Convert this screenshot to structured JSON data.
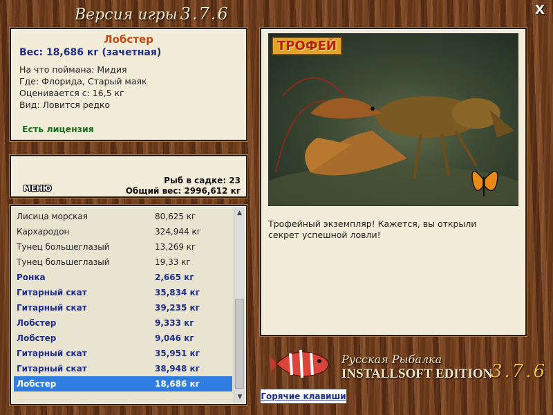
{
  "window": {
    "title_prefix": "Версия игры",
    "title_version": "3.7.6",
    "close_label": "X"
  },
  "fish": {
    "name": "Лобстер",
    "weight": "Вес: 18,686 кг (зачетная)",
    "bait": "На что поймана: Мидия",
    "location": "Где: Флорида, Старый маяк",
    "value": "Оценивается с: 16,5 кг",
    "kind": "Вид: Ловится редко",
    "license": "Есть лицензия"
  },
  "stats": {
    "fish_count": "Рыб в садке: 23",
    "total_weight": "Общий вес: 2996,612 кг",
    "menu_label": "МЕНЮ"
  },
  "catch_list": [
    {
      "name": "Лисица морская",
      "weight": "80,625 кг",
      "bold": false
    },
    {
      "name": "Кархародон",
      "weight": "324,944 кг",
      "bold": false
    },
    {
      "name": "Тунец большеглазый",
      "weight": "13,269 кг",
      "bold": false
    },
    {
      "name": "Тунец большеглазый",
      "weight": "19,33 кг",
      "bold": false
    },
    {
      "name": "Ронка",
      "weight": "2,665 кг",
      "bold": true
    },
    {
      "name": "Гитарный скат",
      "weight": "35,834 кг",
      "bold": true
    },
    {
      "name": "Гитарный скат",
      "weight": "39,235 кг",
      "bold": true
    },
    {
      "name": "Лобстер",
      "weight": "9,333 кг",
      "bold": true
    },
    {
      "name": "Лобстер",
      "weight": "9,046 кг",
      "bold": true
    },
    {
      "name": "Гитарный скат",
      "weight": "35,951 кг",
      "bold": true
    },
    {
      "name": "Гитарный скат",
      "weight": "38,948 кг",
      "bold": true
    },
    {
      "name": "Лобстер",
      "weight": "18,686 кг",
      "bold": true,
      "selected": true
    }
  ],
  "trophy": {
    "badge": "ТРОФЕЙ",
    "description": "Трофейный экземпляр! Кажется, вы открыли секрет успешной ловли!"
  },
  "footer": {
    "hotkeys_label": "Горячие клавиши",
    "brand_line1": "Русская Рыбалка",
    "brand_line2": "INSTALLSOFT EDITION",
    "brand_version": "3.7.6"
  },
  "colors": {
    "accent_blue": "#1e2e8a",
    "fish_name": "#c24a14",
    "license_green": "#1e6b1e",
    "selection": "#2f7de0"
  }
}
